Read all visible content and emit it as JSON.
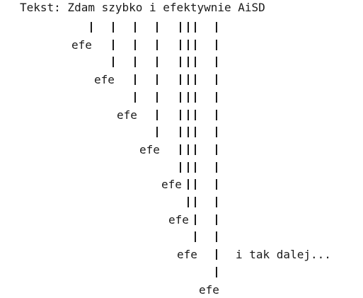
{
  "header": {
    "text": "Tekst: Zdam szybko i efektywnie AiSD"
  },
  "marker_label": "efe",
  "continuation": "i tak dalej...",
  "colors": {
    "ink": "#1a1a1a",
    "background": "#ffffff"
  },
  "bar_rows": [
    {
      "bars": [
        "c1",
        "c2",
        "c3",
        "c4",
        "c5a",
        "c5b",
        "c5c",
        "c6"
      ]
    },
    {
      "label": "efe",
      "bars": [
        "c2",
        "c3",
        "c4",
        "c5a",
        "c5b",
        "c5c",
        "c6"
      ]
    },
    {
      "bars": [
        "c2",
        "c3",
        "c4",
        "c5a",
        "c5b",
        "c5c",
        "c6"
      ]
    },
    {
      "label": "efe",
      "bars": [
        "c3",
        "c4",
        "c5a",
        "c5b",
        "c5c",
        "c6"
      ]
    },
    {
      "bars": [
        "c3",
        "c4",
        "c5a",
        "c5b",
        "c5c",
        "c6"
      ]
    },
    {
      "label": "efe",
      "bars": [
        "c4",
        "c5a",
        "c5b",
        "c5c",
        "c6"
      ]
    },
    {
      "bars": [
        "c4",
        "c5a",
        "c5b",
        "c5c",
        "c6"
      ]
    },
    {
      "label": "efe",
      "bars": [
        "c5a",
        "c5b",
        "c5c",
        "c6"
      ]
    },
    {
      "bars": [
        "c5a",
        "c5b",
        "c5c",
        "c6"
      ]
    },
    {
      "label": "efe",
      "bars": [
        "c5b",
        "c5c",
        "c6"
      ]
    },
    {
      "bars": [
        "c5b",
        "c5c",
        "c6"
      ]
    },
    {
      "label": "efe",
      "bars": [
        "c5c",
        "c6"
      ]
    },
    {
      "bars": [
        "c5c",
        "c6"
      ]
    },
    {
      "label": "efe",
      "bars": [
        "c6"
      ],
      "note": "i tak dalej..."
    },
    {
      "bars": [
        "c6"
      ]
    },
    {
      "label": "efe",
      "bars": []
    }
  ]
}
